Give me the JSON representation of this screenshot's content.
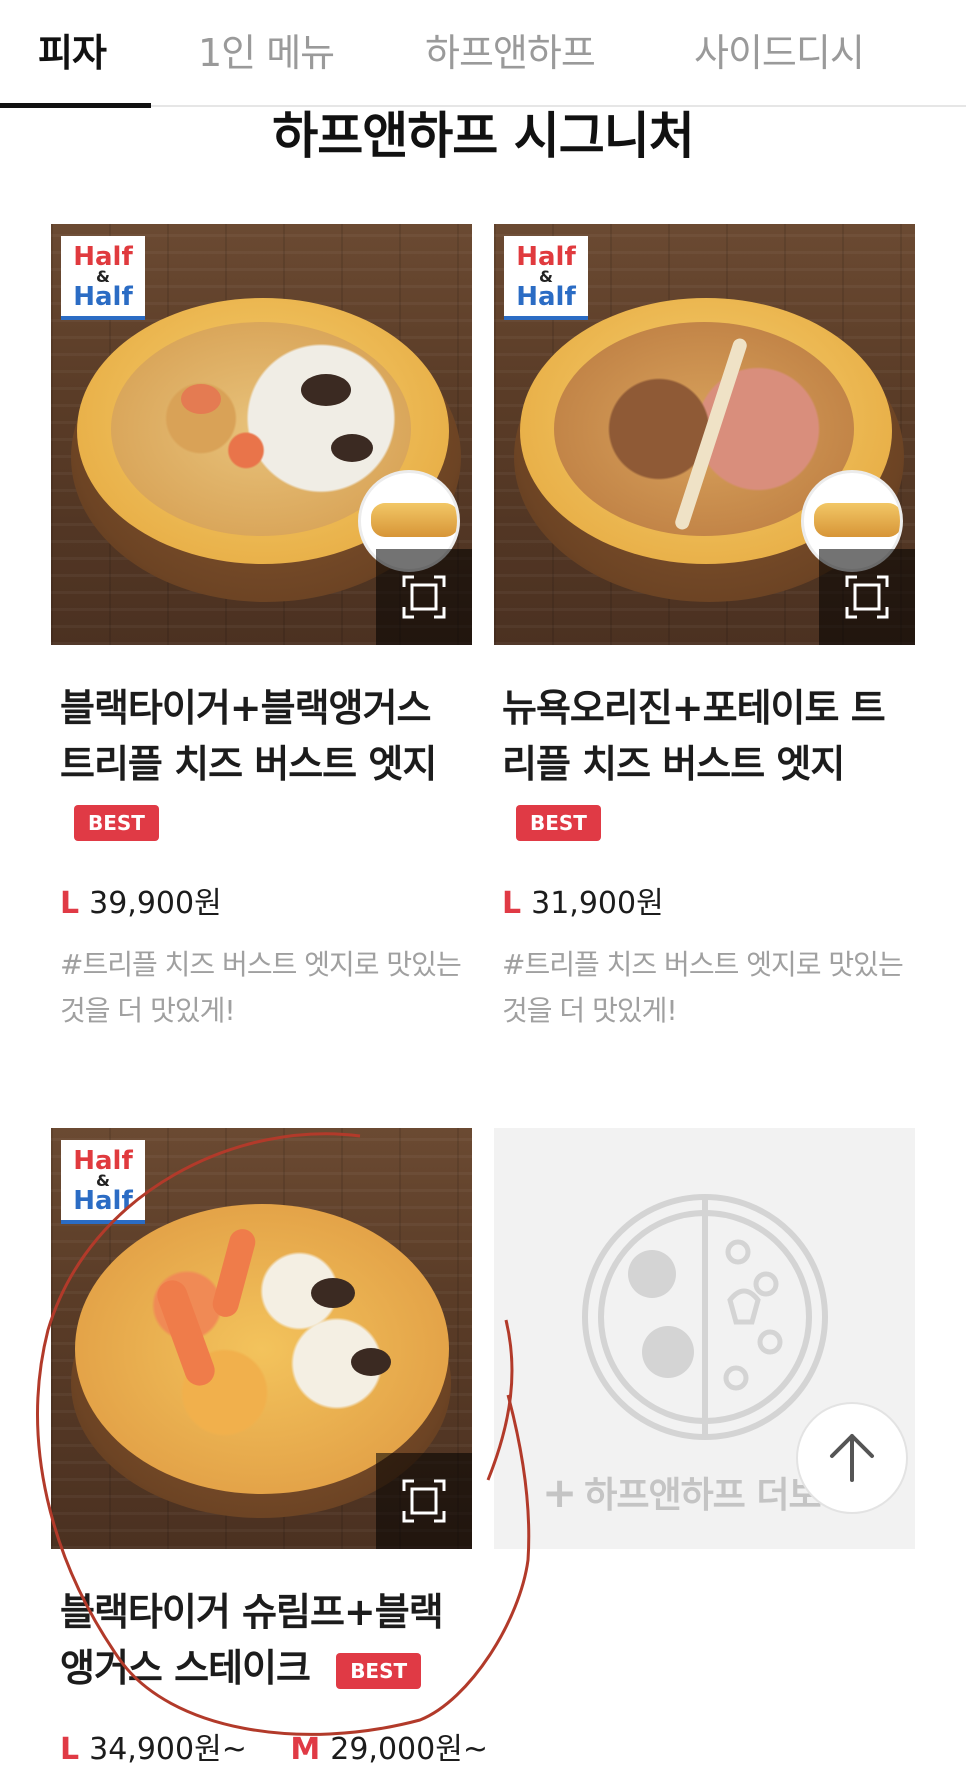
{
  "tabs": [
    {
      "label": "피자",
      "active": true
    },
    {
      "label": "1인 메뉴",
      "active": false
    },
    {
      "label": "하프앤하프",
      "active": false
    },
    {
      "label": "사이드디시",
      "active": false
    }
  ],
  "section_title": "하프앤하프 시그니처",
  "badge": {
    "line1": "Half",
    "amp": "&",
    "line2": "Half"
  },
  "products": [
    {
      "name": "블랙타이거+블랙앵거스 트리플 치즈 버스트 엣지",
      "best_label": "BEST",
      "prices": [
        {
          "size": "L",
          "amount": "39,900원"
        }
      ],
      "description": "#트리플 치즈 버스트 엣지로 맛있는 것을 더 맛있게!"
    },
    {
      "name": "뉴욕오리진+포테이토 트리플 치즈 버스트 엣지",
      "best_label": "BEST",
      "prices": [
        {
          "size": "L",
          "amount": "31,900원"
        }
      ],
      "description": "#트리플 치즈 버스트 엣지로 맛있는 것을 더 맛있게!"
    },
    {
      "name": "블랙타이거 슈림프+블랙앵거스 스테이크",
      "best_label": "BEST",
      "prices": [
        {
          "size": "L",
          "amount": "34,900원~"
        },
        {
          "size": "M",
          "amount": "29,000원~"
        }
      ]
    }
  ],
  "more_card": {
    "label": "하프앤하프 더보기"
  },
  "icons": {
    "zoom": "zoom-frame-icon",
    "placeholder": "half-half-pizza-icon",
    "scroll_top": "arrow-up-icon",
    "more": "plus-icon"
  },
  "colors": {
    "accent": "#e03a45",
    "badge_blue": "#2b6cc4",
    "annotation": "#b23a2a"
  }
}
